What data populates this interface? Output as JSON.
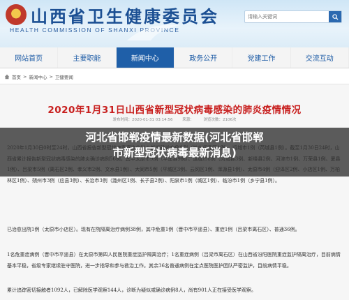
{
  "header": {
    "title": "山西省卫生健康委员会",
    "subtitle": "HEALTH COMMISSION OF SHANXI PROVINCE",
    "search_placeholder": "请输入关键词"
  },
  "nav": {
    "items": [
      "网站首页",
      "主要职能",
      "新闻中心",
      "政务公开",
      "党建工作",
      "交流互动"
    ],
    "active_index": 2
  },
  "breadcrumb": {
    "items": [
      "首页",
      "新闻中心",
      "卫健要闻"
    ]
  },
  "article": {
    "title": "2020年1月31日山西省新型冠状病毒感染的肺炎疫情情况",
    "meta_date": "发布时间：2020-01-31 03:14:56",
    "meta_source": "来源：",
    "meta_views": "浏览次数：2106次"
  },
  "overlay": {
    "line1": "河北省邯郸疫情最新数据(河北省邯郸",
    "line2": "市新型冠状病毒最新消息)"
  },
  "paragraphs": {
    "p1": "2020年1月30日0时至24时，山西省报告新型冠状病毒感染的肺炎新增确诊病例8例（其中迎泽区1例）、运城市1例（芮城县1例）。截至1月30日24时，山西省累计报告新型冠状病毒感染的肺炎确诊病例56例，其中太原市9例（平遥县9例）、运城市8例（芮城县3例、新绛县2例、河津市1例、万荣县1例、夏县1例）、吕梁市5例（离石区2例、孝义市2例、文水县1例）、大同市5例（平城区3例、云冈区1例、浑源县1例）、太原市4例（迎泽区2例、小店区1例、万柏林区1例）、朔州市3例（应县3例）、长治市3例（潞州区1例、长子县2例）、阳泉市1例（城区1例）、临汾市1例（乡宁县1例）。",
    "p2": "已治愈出院1例（太原市小店区）。现有在院隔离治疗病例38例，其中危重1例（晋中市平遥县）、重症1例（吕梁市离石区）、普通36例。",
    "p3": "1名危重症病例（晋中市平遥县）在太原市第四人民医院重症监护隔离治疗；1名重症病例（吕梁市离石区）在山西省汾阳医院重症监护隔离治疗，目前病情基本平稳，省级专家继续驻守医院，进一步指导和参与救治工作。其余36名普通病例在定点医院医护团队严密监护，目前病情平稳。",
    "p4": "累计追踪密切接触者1092人，已解除医学观察144人，诊断为疑似或确诊病例8人，尚有901人正在接受医学观察。"
  }
}
